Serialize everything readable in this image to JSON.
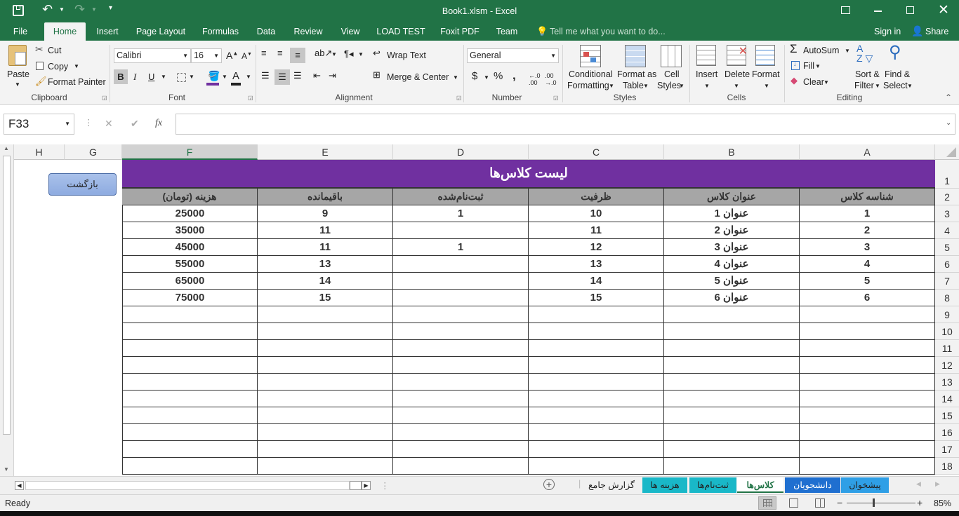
{
  "window": {
    "title": "Book1.xlsm - Excel"
  },
  "menu_tabs": [
    "File",
    "Home",
    "Insert",
    "Page Layout",
    "Formulas",
    "Data",
    "Review",
    "View",
    "LOAD TEST",
    "Foxit PDF",
    "Team"
  ],
  "tell_me": "Tell me what you want to do...",
  "signin": "Sign in",
  "share": "Share",
  "ribbon": {
    "clipboard": {
      "paste": "Paste",
      "cut": "Cut",
      "copy": "Copy",
      "format_painter": "Format Painter",
      "label": "Clipboard"
    },
    "font": {
      "name": "Calibri",
      "size": "16",
      "label": "Font",
      "bold": "B",
      "italic": "I",
      "underline": "U"
    },
    "alignment": {
      "wrap": "Wrap Text",
      "merge": "Merge & Center",
      "label": "Alignment"
    },
    "number": {
      "format": "General",
      "label": "Number",
      "currency": "$",
      "percent": "%",
      "comma": ","
    },
    "styles": {
      "cond1": "Conditional",
      "cond2": "Formatting",
      "fat1": "Format as",
      "fat2": "Table",
      "cs1": "Cell",
      "cs2": "Styles",
      "label": "Styles"
    },
    "cells": {
      "insert": "Insert",
      "delete": "Delete",
      "format": "Format",
      "label": "Cells"
    },
    "editing": {
      "autosum": "AutoSum",
      "fill": "Fill",
      "clear": "Clear",
      "sort1": "Sort &",
      "sort2": "Filter",
      "find1": "Find &",
      "find2": "Select",
      "label": "Editing"
    }
  },
  "formula_bar": {
    "name_box": "F33",
    "fx": "fx",
    "formula": ""
  },
  "columns": [
    "H",
    "G",
    "F",
    "E",
    "D",
    "C",
    "B",
    "A"
  ],
  "rows": [
    "1",
    "2",
    "3",
    "4",
    "5",
    "6",
    "7",
    "8",
    "9",
    "10",
    "11",
    "12",
    "13",
    "14",
    "15",
    "16",
    "17",
    "18"
  ],
  "back_button": "بازگشت",
  "table": {
    "title": "لیست کلاس‌ها",
    "headers": [
      "شناسه کلاس",
      "عنوان کلاس",
      "ظرفیت",
      "ثبت‌نام‌شده",
      "باقیمانده",
      "هزینه (تومان)"
    ],
    "rows": [
      [
        "1",
        "عنوان 1",
        "10",
        "1",
        "9",
        "25000"
      ],
      [
        "2",
        "عنوان 2",
        "11",
        "",
        "11",
        "35000"
      ],
      [
        "3",
        "عنوان 3",
        "12",
        "1",
        "11",
        "45000"
      ],
      [
        "4",
        "عنوان 4",
        "13",
        "",
        "13",
        "55000"
      ],
      [
        "5",
        "عنوان 5",
        "14",
        "",
        "14",
        "65000"
      ],
      [
        "6",
        "عنوان 6",
        "15",
        "",
        "15",
        "75000"
      ]
    ]
  },
  "sheets": [
    {
      "name": "پیشخوان",
      "color": "#2f9fe6"
    },
    {
      "name": "دانشجویان",
      "color": "#1f6fd0"
    },
    {
      "name": "کلاس‌ها",
      "color": "#ffffff",
      "active": true
    },
    {
      "name": "ثبت‌نام‌ها",
      "color": "#19b8c8"
    },
    {
      "name": "هزینه ها",
      "color": "#19b8c8"
    },
    {
      "name": "گزارش جامع",
      "color": "#f0f0f0"
    }
  ],
  "status": {
    "ready": "Ready",
    "zoom": "85%"
  },
  "colors": {
    "accent": "#217346",
    "title_band": "#7030a0",
    "header_fill": "#a6a6a6"
  }
}
